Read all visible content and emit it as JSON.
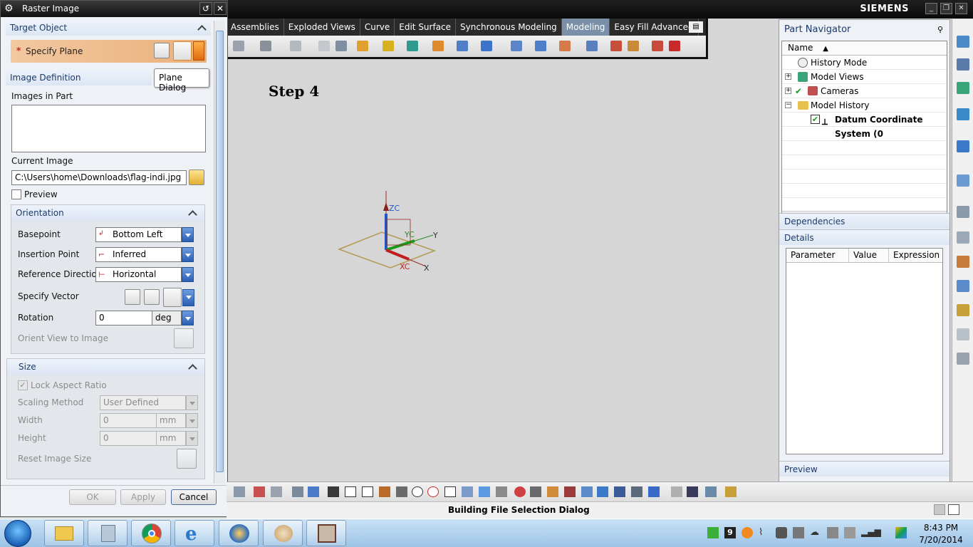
{
  "app": {
    "brand": "SIEMENS",
    "step_label": "Step 4",
    "status_text": "Building File Selection Dialog",
    "tabs": [
      {
        "label": "Assemblies"
      },
      {
        "label": "Exploded Views"
      },
      {
        "label": "Curve"
      },
      {
        "label": "Edit Surface"
      },
      {
        "label": "Synchronous Modeling"
      },
      {
        "label": "Modeling",
        "active": true
      },
      {
        "label": "Easy Fill Advanced"
      }
    ]
  },
  "dialog": {
    "title": "Raster Image",
    "target_object": {
      "header": "Target Object",
      "specify_plane": "Specify Plane",
      "required_marker": "*"
    },
    "tooltip": "Plane Dialog",
    "image_definition": {
      "header": "Image Definition",
      "images_in_part_label": "Images in Part",
      "current_image_label": "Current Image",
      "current_image_value": "C:\\Users\\home\\Downloads\\flag-indi.jpg",
      "preview_label": "Preview",
      "preview_checked": false
    },
    "orientation": {
      "header": "Orientation",
      "basepoint_label": "Basepoint",
      "basepoint_value": "Bottom Left",
      "insertion_point_label": "Insertion Point",
      "insertion_point_value": "Inferred",
      "reference_direction_label": "Reference Direction",
      "reference_direction_value": "Horizontal",
      "specify_vector_label": "Specify Vector",
      "rotation_label": "Rotation",
      "rotation_value": "0",
      "rotation_unit": "deg",
      "orient_view_label": "Orient View to Image"
    },
    "size": {
      "header": "Size",
      "lock_aspect_label": "Lock Aspect Ratio",
      "lock_aspect_checked": true,
      "scaling_method_label": "Scaling Method",
      "scaling_method_value": "User Defined",
      "width_label": "Width",
      "width_value": "0",
      "width_unit": "mm",
      "height_label": "Height",
      "height_value": "0",
      "height_unit": "mm",
      "reset_label": "Reset Image Size"
    },
    "buttons": {
      "ok": "OK",
      "apply": "Apply",
      "cancel": "Cancel"
    }
  },
  "part_navigator": {
    "title": "Part Navigator",
    "column_name": "Name",
    "items": [
      {
        "label": "History Mode"
      },
      {
        "label": "Model Views"
      },
      {
        "label": "Cameras"
      },
      {
        "label": "Model History"
      },
      {
        "label": "Datum Coordinate System (0"
      }
    ],
    "dependencies": "Dependencies",
    "details": "Details",
    "details_columns": [
      "Parameter",
      "Value",
      "Expression"
    ],
    "preview": "Preview"
  },
  "triad": {
    "zc": "ZC",
    "yc": "YC",
    "y": "Y",
    "xc": "XC",
    "x": "X"
  },
  "taskbar": {
    "time": "8:43 PM",
    "date": "7/20/2014",
    "badge": "9"
  },
  "colors": {
    "accent": "#2b5fb4",
    "specify_plane_bg": "#f0c29a",
    "active_tab": "#7a8fa8"
  }
}
